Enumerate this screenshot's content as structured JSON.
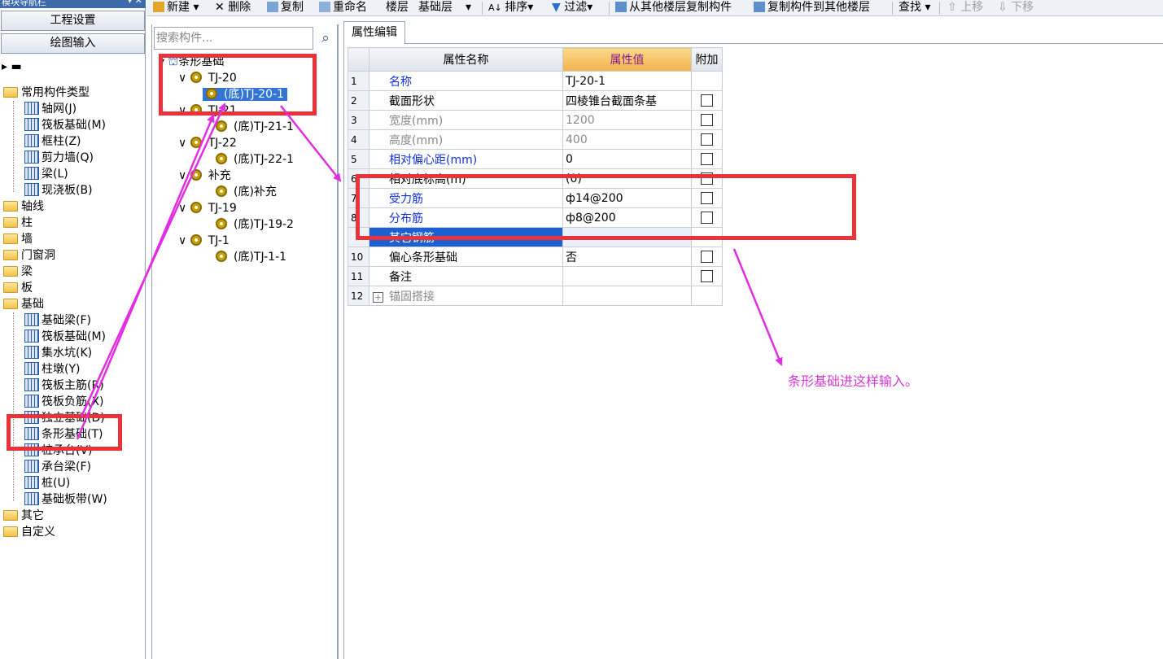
{
  "nav": {
    "title": "模块导航栏",
    "pins": "▾ ✕",
    "btn_settings": "工程设置",
    "btn_drawing": "绘图输入",
    "tree": {
      "common": "常用构件类型",
      "common_items": [
        "轴网(J)",
        "筏板基础(M)",
        "框柱(Z)",
        "剪力墙(Q)",
        "梁(L)",
        "现浇板(B)"
      ],
      "axis": "轴线",
      "column": "柱",
      "wall": "墙",
      "door": "门窗洞",
      "beam": "梁",
      "slab": "板",
      "foundation": "基础",
      "foundation_items": [
        "基础梁(F)",
        "筏板基础(M)",
        "集水坑(K)",
        "柱墩(Y)",
        "筏板主筋(R)",
        "筏板负筋(X)",
        "独立基础(D)",
        "条形基础(T)",
        "桩承台(V)",
        "承台梁(F)",
        "桩(U)",
        "基础板带(W)"
      ],
      "other": "其它",
      "custom": "自定义"
    }
  },
  "toolbar": {
    "new": "新建",
    "delete": "删除",
    "copy": "复制",
    "rename": "重命名",
    "floor_label": "楼层",
    "floor_value": "基础层",
    "sort": "排序",
    "filter": "过滤",
    "copy_from": "从其他楼层复制构件",
    "copy_to": "复制构件到其他楼层",
    "find": "查找",
    "move_up": "上移",
    "move_down": "下移"
  },
  "components": {
    "search_placeholder": "搜索构件...",
    "root": "条形基础",
    "groups": [
      {
        "name": "TJ-20",
        "child": "(底)TJ-20-1"
      },
      {
        "name": "TJ-21",
        "child": "(底)TJ-21-1"
      },
      {
        "name": "TJ-22",
        "child": "(底)TJ-22-1"
      },
      {
        "name": "补充",
        "child": "(底)补充"
      },
      {
        "name": "TJ-19",
        "child": "(底)TJ-19-2"
      },
      {
        "name": "TJ-1",
        "child": "(底)TJ-1-1"
      }
    ]
  },
  "properties": {
    "tab": "属性编辑",
    "col_name": "属性名称",
    "col_value": "属性值",
    "col_add": "附加",
    "rows": [
      {
        "no": "1",
        "name": "名称",
        "value": "TJ-20-1"
      },
      {
        "no": "2",
        "name": "截面形状",
        "value": "四棱锥台截面条基"
      },
      {
        "no": "3",
        "name": "宽度(mm)",
        "value": "1200"
      },
      {
        "no": "4",
        "name": "高度(mm)",
        "value": "400"
      },
      {
        "no": "5",
        "name": "相对偏心距(mm)",
        "value": "0"
      },
      {
        "no": "6",
        "name": "相对底标高(m)",
        "value": "(0)"
      },
      {
        "no": "7",
        "name": "受力筋",
        "value": "ф14@200"
      },
      {
        "no": "8",
        "name": "分布筋",
        "value": "ф8@200"
      },
      {
        "no": "9",
        "name": "其它钢筋",
        "value": ""
      },
      {
        "no": "10",
        "name": "偏心条形基础",
        "value": "否"
      },
      {
        "no": "11",
        "name": "备注",
        "value": ""
      },
      {
        "no": "12",
        "name": "锚固搭接",
        "value": ""
      }
    ]
  },
  "annotation": {
    "note": "条形基础进这样输入。",
    "color": "#d63ad6",
    "box_color": "#e8333a"
  }
}
